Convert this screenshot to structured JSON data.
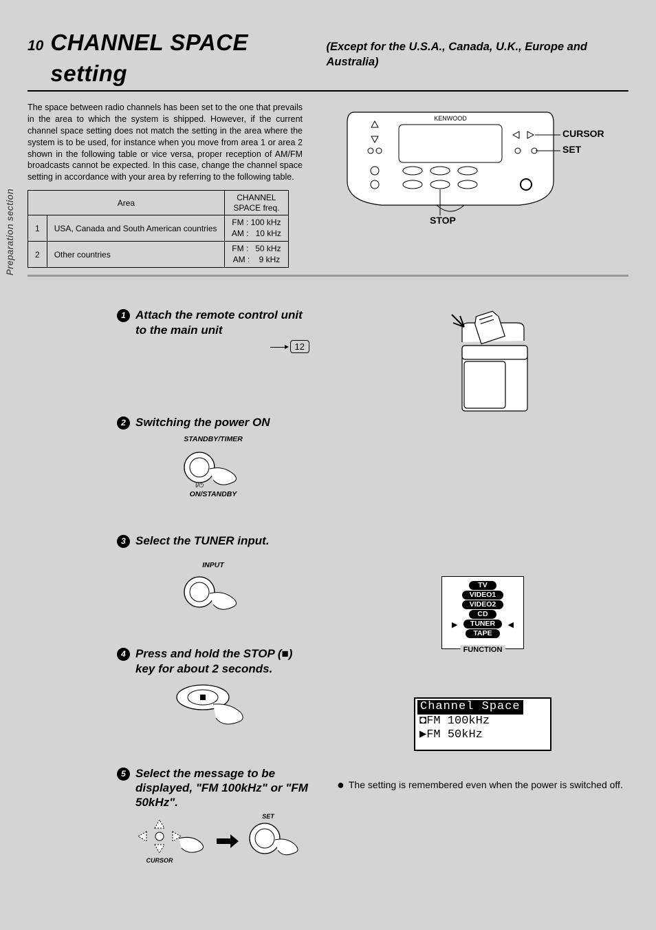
{
  "page_number": "10",
  "title_main": "CHANNEL SPACE setting",
  "title_sub": "(Except for the U.S.A., Canada, U.K., Europe and Australia)",
  "intro_paragraph": "The space between radio channels has been set to the one that prevails in the area to which the system is shipped. However, if the current channel space setting does not match the setting in the area where the system is to be used, for instance when you move from area 1 or area 2 shown in the following table or vice versa, proper reception of AM/FM broadcasts cannot be expected. In this case, change the channel space setting in accordance with your area by referring to the following table.",
  "table": {
    "head_area": "Area",
    "head_freq": "CHANNEL\nSPACE freq.",
    "rows": [
      {
        "n": "1",
        "area": "USA, Canada and South American countries",
        "freq": "FM : 100 kHz\nAM :   10 kHz"
      },
      {
        "n": "2",
        "area": "Other countries",
        "freq": "FM :   50 kHz\nAM :    9 kHz"
      }
    ]
  },
  "device_labels": {
    "brand": "KENWOOD",
    "cursor": "CURSOR",
    "set": "SET",
    "stop": "STOP"
  },
  "side_tab": "Preparation section",
  "steps": [
    {
      "n": "1",
      "text": "Attach the remote control unit to the main unit",
      "page_ref": "12"
    },
    {
      "n": "2",
      "text": "Switching the power ON",
      "label_top": "STANDBY/TIMER",
      "label_bottom": "ON/STANDBY"
    },
    {
      "n": "3",
      "text": "Select the TUNER input.",
      "label_top": "INPUT"
    },
    {
      "n": "4",
      "text": "Press and hold the STOP (■) key for about 2 seconds."
    },
    {
      "n": "5",
      "text": "Select the message to be displayed, \"FM 100kHz\" or \"FM 50kHz\".",
      "label_cursor": "CURSOR",
      "label_set": "SET"
    }
  ],
  "function_box": {
    "items": [
      "TV",
      "VIDEO1",
      "VIDEO2",
      "CD",
      "TUNER",
      "TAPE"
    ],
    "selected_index": 4,
    "caption": "FUNCTION"
  },
  "lcd": {
    "title": "Channel Space",
    "row1": "◘FM 100kHz",
    "row2": "▶FM  50kHz"
  },
  "note": "The setting is remembered even when the power is switched off."
}
